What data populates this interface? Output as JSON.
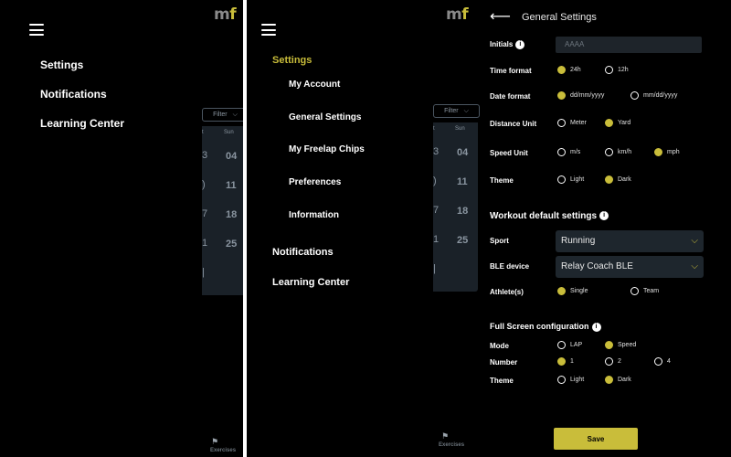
{
  "colors": {
    "accent": "#c9bd3a",
    "background": "#000000",
    "surface": "#1e262d"
  },
  "logo": {
    "m": "m",
    "f": "f"
  },
  "panel1": {
    "menu": [
      "Settings",
      "Notifications",
      "Learning Center"
    ],
    "filter": {
      "label": "Filter",
      "chevron": "⌵"
    },
    "calendar": {
      "header_cut": "t",
      "header": "Sun",
      "rows": [
        {
          "cut": "3",
          "day": "04"
        },
        {
          "cut": ")",
          "day": "11"
        },
        {
          "cut": "7",
          "day": "18"
        },
        {
          "cut": "1",
          "day": "25"
        },
        {
          "cut": "|",
          "day": ""
        }
      ]
    },
    "tab_label": "Exercises"
  },
  "panel2": {
    "settings": "Settings",
    "submenu": [
      "My Account",
      "General Settings",
      "My Freelap Chips",
      "Preferences",
      "Information"
    ],
    "notifications": "Notifications",
    "learning": "Learning Center",
    "filter": {
      "label": "Filter",
      "chevron": "⌵"
    },
    "calendar": {
      "header_cut": "t",
      "header": "Sun",
      "rows": [
        {
          "cut": "3",
          "day": "04"
        },
        {
          "cut": ")",
          "day": "11"
        },
        {
          "cut": "7",
          "day": "18"
        },
        {
          "cut": "1",
          "day": "25"
        },
        {
          "cut": "|",
          "day": ""
        }
      ]
    },
    "tab_label": "Exercises"
  },
  "general": {
    "back_icon": "arrow-left-icon",
    "title": "General Settings",
    "initials": {
      "label": "Initials",
      "placeholder": "AAAA"
    },
    "time_format": {
      "label": "Time format",
      "options": [
        "24h",
        "12h"
      ],
      "selected": "24h"
    },
    "date_format": {
      "label": "Date format",
      "options": [
        "dd/mm/yyyy",
        "mm/dd/yyyy"
      ],
      "selected": "dd/mm/yyyy"
    },
    "distance_unit": {
      "label": "Distance Unit",
      "options": [
        "Meter",
        "Yard"
      ],
      "selected": "Yard"
    },
    "speed_unit": {
      "label": "Speed Unit",
      "options": [
        "m/s",
        "km/h",
        "mph"
      ],
      "selected": "mph"
    },
    "theme": {
      "label": "Theme",
      "options": [
        "Light",
        "Dark"
      ],
      "selected": "Dark"
    },
    "workout_title": "Workout default settings",
    "sport": {
      "label": "Sport",
      "value": "Running"
    },
    "ble_device": {
      "label": "BLE device",
      "value": "Relay Coach BLE"
    },
    "athletes": {
      "label": "Athlete(s)",
      "options": [
        "Single",
        "Team"
      ],
      "selected": "Single"
    },
    "fullscreen_title": "Full Screen configuration",
    "mode": {
      "label": "Mode",
      "options": [
        "LAP",
        "Speed"
      ],
      "selected": "Speed"
    },
    "number": {
      "label": "Number",
      "options": [
        "1",
        "2",
        "4"
      ],
      "selected": "1"
    },
    "fs_theme": {
      "label": "Theme",
      "options": [
        "Light",
        "Dark"
      ],
      "selected": "Dark"
    },
    "save": "Save"
  }
}
